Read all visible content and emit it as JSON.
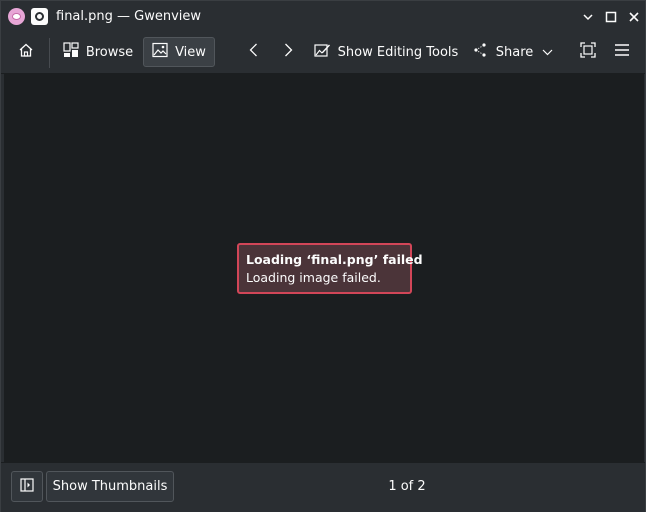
{
  "window": {
    "title": "final.png — Gwenview",
    "app_icon": "gwenview-app-icon",
    "controls": {
      "pin_icon": "keep-above-icon",
      "minimize_icon": "minimize-icon",
      "maximize_icon": "maximize-icon",
      "close_icon": "close-icon"
    }
  },
  "toolbar": {
    "home_icon": "home-icon",
    "browse_label": "Browse",
    "view_label": "View",
    "prev_icon": "chevron-left-icon",
    "next_icon": "chevron-right-icon",
    "editing_tools_label": "Show Editing Tools",
    "share_label": "Share",
    "fullscreen_icon": "fullscreen-icon",
    "menu_icon": "hamburger-menu-icon",
    "active_mode": "View"
  },
  "error": {
    "title": "Loading ‘final.png’ failed",
    "message": "Loading image failed."
  },
  "statusbar": {
    "sidebar_toggle_icon": "sidebar-toggle-icon",
    "thumbnails_label": "Show Thumbnails",
    "counter": "1 of 2"
  },
  "colors": {
    "window_bg": "#2a2e32",
    "viewport_bg": "#1b1e20",
    "error_border": "#d24658",
    "error_bg": "#4b3439",
    "text": "#fcfcfc"
  }
}
